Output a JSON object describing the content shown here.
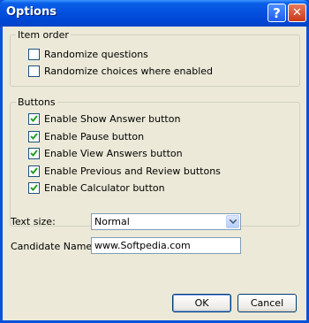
{
  "window": {
    "title": "Options",
    "help_glyph": "?",
    "close_glyph": "✕"
  },
  "item_order": {
    "legend": "Item order",
    "options": [
      {
        "label": "Randomize questions",
        "checked": false
      },
      {
        "label": "Randomize choices where enabled",
        "checked": false
      }
    ]
  },
  "buttons_group": {
    "legend": "Buttons",
    "options": [
      {
        "label": "Enable Show Answer button",
        "checked": true
      },
      {
        "label": "Enable Pause button",
        "checked": true
      },
      {
        "label": "Enable View Answers button",
        "checked": true
      },
      {
        "label": "Enable Previous and Review buttons",
        "checked": true
      },
      {
        "label": "Enable Calculator button",
        "checked": true
      }
    ]
  },
  "text_size": {
    "label": "Text size:",
    "value": "Normal"
  },
  "candidate": {
    "label": "Candidate Name:",
    "value": "www.Softpedia.com"
  },
  "actions": {
    "ok": "OK",
    "cancel": "Cancel"
  },
  "colors": {
    "titlebar": "#0054e3",
    "face": "#ece9d8",
    "check": "#21a121"
  }
}
